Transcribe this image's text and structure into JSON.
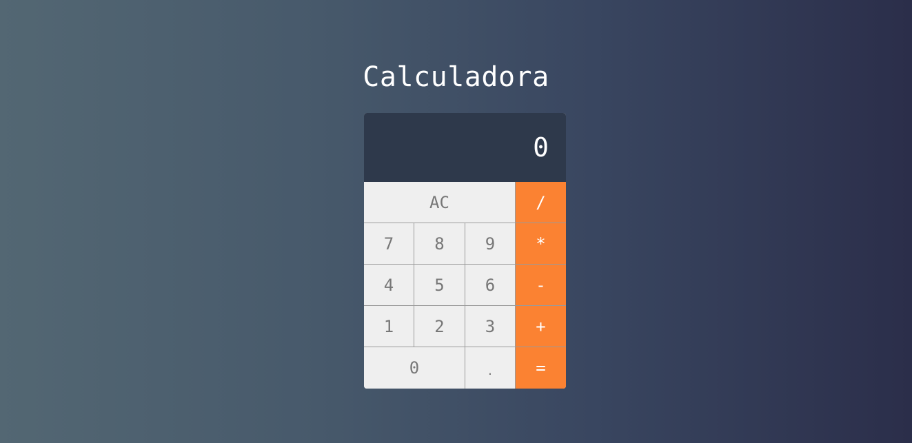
{
  "page": {
    "title": "Calculadora"
  },
  "display": {
    "value": "0"
  },
  "keys": {
    "clear": "AC",
    "divide": "/",
    "seven": "7",
    "eight": "8",
    "nine": "9",
    "multiply": "*",
    "four": "4",
    "five": "5",
    "six": "6",
    "subtract": "-",
    "one": "1",
    "two": "2",
    "three": "3",
    "add": "+",
    "zero": "0",
    "decimal": ".",
    "equals": "="
  },
  "colors": {
    "display_bg": "#2e394b",
    "key_bg": "#efefef",
    "operator_bg": "#fb8232",
    "background_start": "#536773",
    "background_end": "#2b2e4a"
  }
}
